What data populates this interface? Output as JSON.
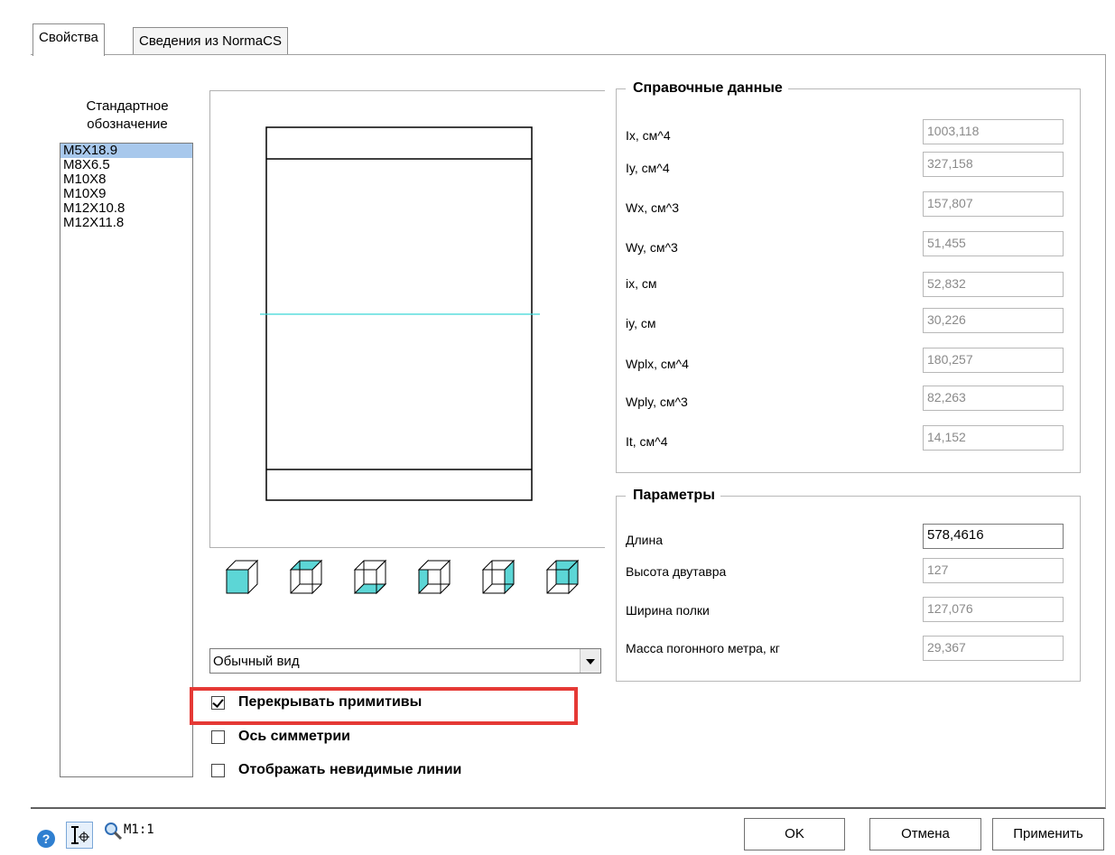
{
  "tabs": {
    "properties": "Свойства",
    "normacs": "Сведения из NormaCS"
  },
  "standard": {
    "header": "Стандартное обозначение",
    "items": [
      "M5X18.9",
      "M8X6.5",
      "M10X8",
      "M10X9",
      "M12X10.8",
      "M12X11.8"
    ],
    "selected_index": 0
  },
  "view": {
    "mode_value": "Обычный вид",
    "buttons": [
      "cube-front-icon",
      "cube-top-icon",
      "cube-bottom-icon",
      "cube-left-icon",
      "cube-right-icon",
      "cube-back-icon"
    ]
  },
  "options": {
    "overlap_label": "Перекрывать примитивы",
    "overlap_checked": true,
    "symmetry_label": "Ось симметрии",
    "symmetry_checked": false,
    "hidden_label": "Отображать невидимые линии",
    "hidden_checked": false
  },
  "reference": {
    "title": "Справочные данные",
    "rows": [
      {
        "label": "Ix, см^4",
        "value": "1003,118"
      },
      {
        "label": "Iy, см^4",
        "value": "327,158"
      },
      {
        "label": "Wx, см^3",
        "value": "157,807"
      },
      {
        "label": "Wy, см^3",
        "value": "51,455"
      },
      {
        "label": "ix, см",
        "value": "52,832"
      },
      {
        "label": "iy, см",
        "value": "30,226"
      },
      {
        "label": "Wplx, см^4",
        "value": "180,257"
      },
      {
        "label": "Wply, см^3",
        "value": "82,263"
      },
      {
        "label": "It, см^4",
        "value": "14,152"
      }
    ]
  },
  "parameters": {
    "title": "Параметры",
    "rows": [
      {
        "label": "Длина",
        "value": "578,4616",
        "editable": true
      },
      {
        "label": "Высота двутавра",
        "value": "127",
        "editable": false
      },
      {
        "label": "Ширина полки",
        "value": "127,076",
        "editable": false
      },
      {
        "label": "Масса погонного метра, кг",
        "value": "29,367",
        "editable": false
      }
    ]
  },
  "footer": {
    "scale": "M1:1",
    "ok": "OK",
    "cancel": "Отмена",
    "apply": "Применить"
  },
  "colors": {
    "accent_cyan": "#5cd6d6",
    "highlight_red": "#e53935",
    "selection": "#a8c8ec"
  }
}
